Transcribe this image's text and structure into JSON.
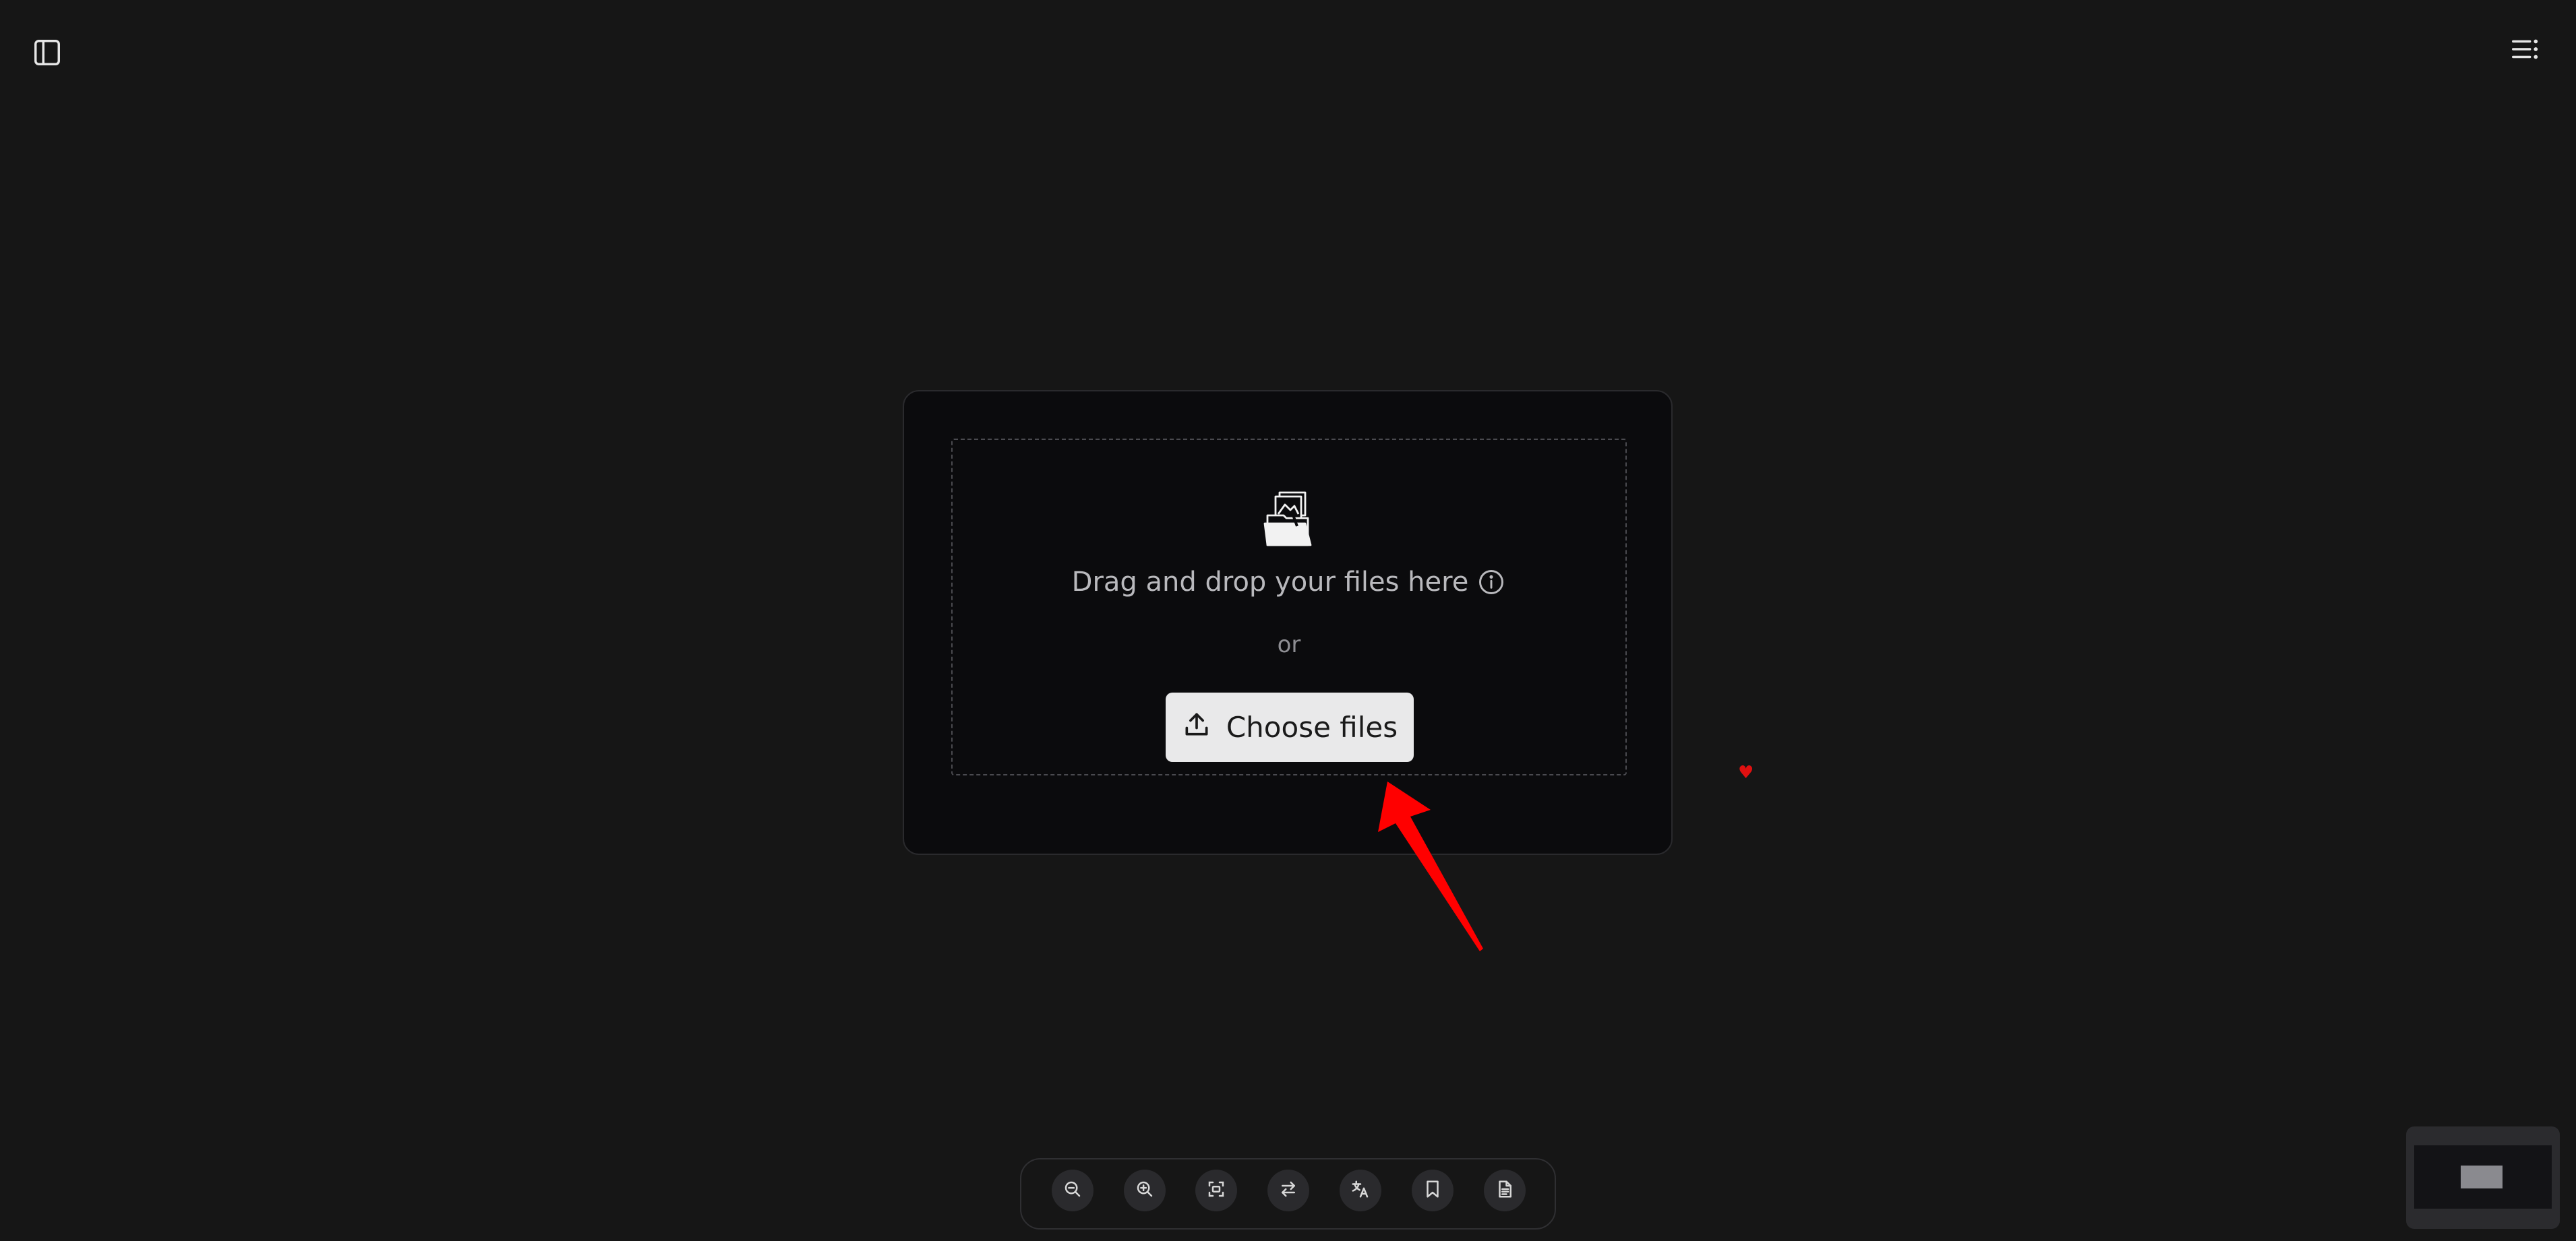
{
  "header": {
    "sidebar_toggle_icon": "sidebar-panel-icon",
    "menu_icon": "list-menu-icon"
  },
  "upload": {
    "drop_icon": "folder-with-images-icon",
    "drag_text": "Drag and drop your files here",
    "info_icon": "info-circle-icon",
    "or_text": "or",
    "choose_label": "Choose files",
    "choose_icon": "upload-icon"
  },
  "toolbar": {
    "items": [
      {
        "icon": "zoom-out-icon"
      },
      {
        "icon": "zoom-in-icon"
      },
      {
        "icon": "fit-screen-icon"
      },
      {
        "icon": "swap-arrows-icon"
      },
      {
        "icon": "translate-icon"
      },
      {
        "icon": "bookmark-icon"
      },
      {
        "icon": "document-icon"
      }
    ]
  },
  "overlay": {
    "annotation_color": "#ff0000"
  }
}
